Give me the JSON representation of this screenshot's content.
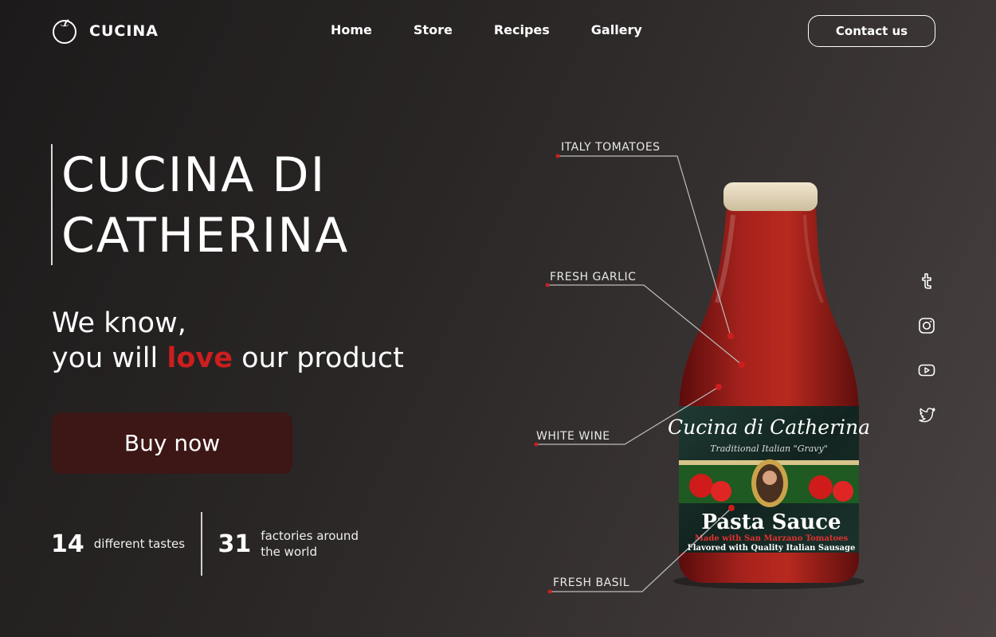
{
  "header": {
    "logo_text": "CUCINA",
    "nav": [
      "Home",
      "Store",
      "Recipes",
      "Gallery"
    ],
    "contact_label": "Contact us"
  },
  "hero": {
    "title_line1": "CUCINA DI",
    "title_line2": "CATHERINA",
    "tagline_line1": "We know,",
    "tagline_pre": "you will ",
    "tagline_love": "love",
    "tagline_post": " our product",
    "buy_label": "Buy now"
  },
  "stats": [
    {
      "number": "14",
      "label_line1": "different tastes",
      "label_line2": ""
    },
    {
      "number": "31",
      "label_line1": "factories around",
      "label_line2": "the world"
    }
  ],
  "annotations": [
    "ITALY TOMATOES",
    "FRESH GARLIC",
    "WHITE WINE",
    "FRESH BASIL"
  ],
  "product_label": {
    "brand": "Cucina di Catherina",
    "subtitle": "Traditional Italian \"Gravy\"",
    "name": "Pasta Sauce",
    "line1": "Made with San Marzano Tomatoes",
    "line2": "Flavored with Quality Italian Sausage"
  },
  "social": [
    "tumblr-icon",
    "instagram-icon",
    "youtube-icon",
    "twitter-icon"
  ],
  "colors": {
    "accent": "#cc1e1e",
    "button": "#3d1616",
    "background": "#2a2626"
  }
}
